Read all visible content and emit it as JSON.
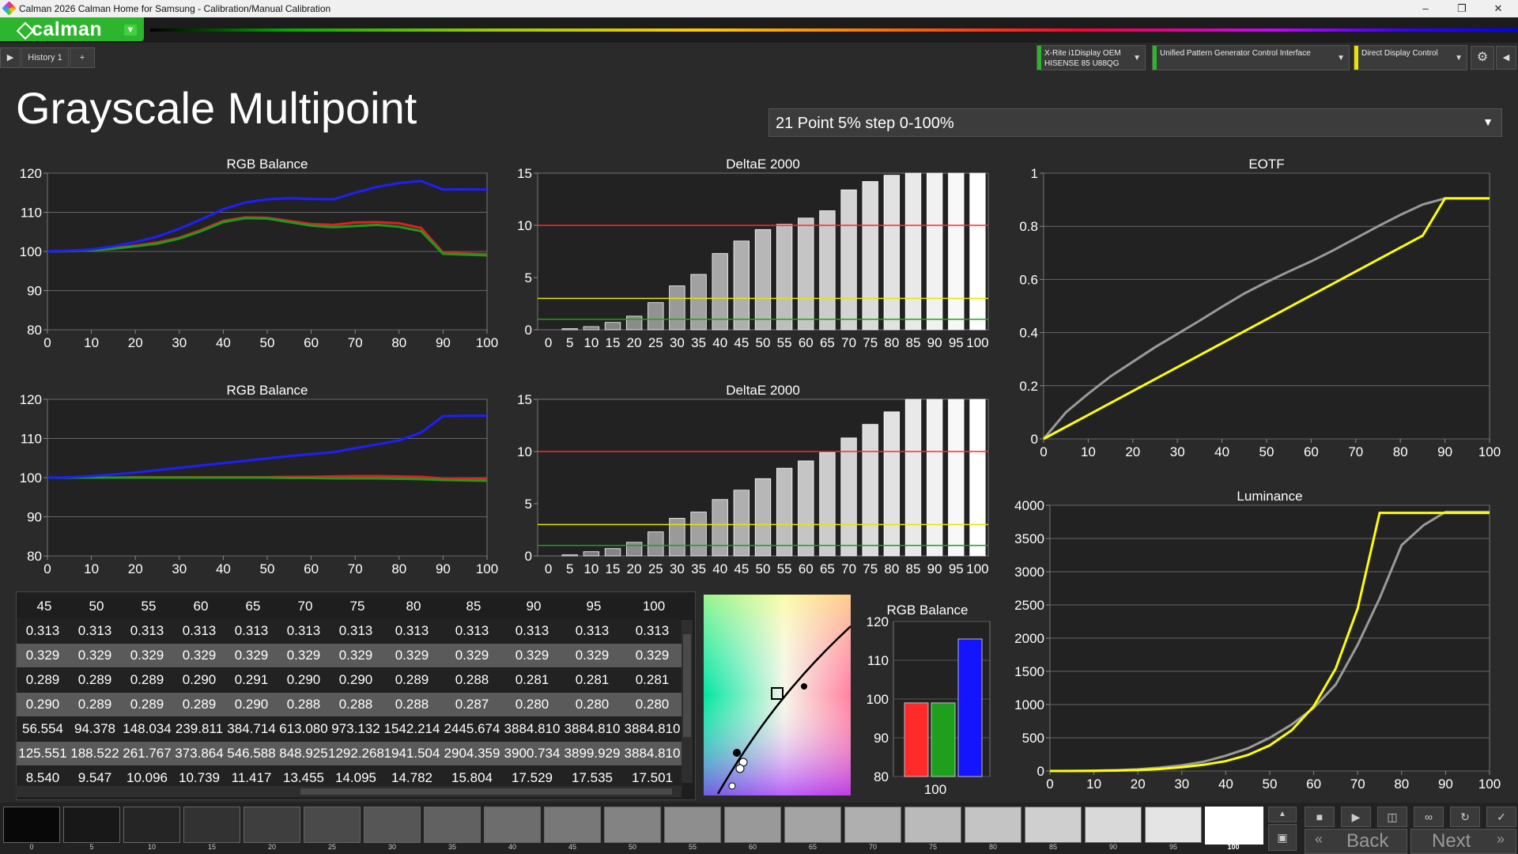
{
  "window": {
    "title": "Calman 2026 Calman Home for Samsung  - Calibration/Manual Calibration"
  },
  "app": {
    "logo": "calman"
  },
  "tabs": {
    "history": "History 1",
    "add": "+"
  },
  "devices": [
    {
      "line1": "X-Rite i1Display OEM",
      "line2": "HISENSE 85 U88QG",
      "color": "#2db52d"
    },
    {
      "line1": "Unified Pattern Generator Control Interface",
      "line2": "",
      "color": "#2db52d"
    },
    {
      "line1": "Direct Display Control",
      "line2": "",
      "color": "#e6e600"
    }
  ],
  "page": {
    "title": "Grayscale Multipoint",
    "preset": "21 Point 5% step 0-100%"
  },
  "chart_data": [
    {
      "id": "rgb1",
      "type": "line",
      "title": "RGB Balance",
      "x": [
        0,
        5,
        10,
        15,
        20,
        25,
        30,
        35,
        40,
        45,
        50,
        55,
        60,
        65,
        70,
        75,
        80,
        85,
        90,
        95,
        100
      ],
      "ylim": [
        80,
        120
      ],
      "yticks": [
        80,
        90,
        100,
        110,
        120
      ],
      "xticks": [
        0,
        10,
        20,
        30,
        40,
        50,
        60,
        70,
        80,
        90,
        100
      ],
      "series": [
        {
          "name": "Red",
          "color": "#e02020",
          "values": [
            100,
            100.1,
            100.3,
            100.8,
            101.5,
            102.3,
            103.5,
            105.5,
            107.8,
            108.7,
            108.6,
            107.8,
            107,
            106.8,
            107.4,
            107.5,
            107.2,
            106,
            99.7,
            99.5,
            99.3
          ]
        },
        {
          "name": "Green",
          "color": "#1e9a1e",
          "values": [
            100,
            100.1,
            100.3,
            100.7,
            101.3,
            102,
            103.3,
            105.2,
            107.5,
            108.5,
            108.4,
            107.5,
            106.6,
            106.2,
            106.5,
            106.8,
            106.3,
            105.2,
            99.4,
            99.2,
            99
          ]
        },
        {
          "name": "Blue",
          "color": "#1e1eff",
          "values": [
            100,
            100.2,
            100.5,
            101.3,
            102.4,
            103.8,
            105.8,
            108.2,
            110.8,
            112.5,
            113.3,
            113.6,
            113.4,
            113.3,
            115,
            116.5,
            117.5,
            118,
            115.8,
            115.9,
            115.8
          ]
        }
      ]
    },
    {
      "id": "de1",
      "type": "bar",
      "title": "DeltaE 2000",
      "categories": [
        "0",
        "5",
        "10",
        "15",
        "20",
        "25",
        "30",
        "35",
        "40",
        "45",
        "50",
        "55",
        "60",
        "65",
        "70",
        "75",
        "80",
        "85",
        "90",
        "95",
        "100"
      ],
      "values": [
        0,
        0.1,
        0.3,
        0.7,
        1.3,
        2.6,
        4.2,
        5.3,
        7.3,
        8.5,
        9.6,
        10.1,
        10.7,
        11.4,
        13.4,
        14.2,
        14.8,
        15.5,
        15.5,
        15.5,
        15.5
      ],
      "ylim": [
        0,
        15
      ],
      "yticks": [
        0,
        5,
        10,
        15
      ],
      "thresholds": [
        10,
        3,
        1
      ]
    },
    {
      "id": "rgb2",
      "type": "line",
      "title": "RGB Balance",
      "x": [
        0,
        5,
        10,
        15,
        20,
        25,
        30,
        35,
        40,
        45,
        50,
        55,
        60,
        65,
        70,
        75,
        80,
        85,
        90,
        95,
        100
      ],
      "ylim": [
        80,
        120
      ],
      "yticks": [
        80,
        90,
        100,
        110,
        120
      ],
      "xticks": [
        0,
        10,
        20,
        30,
        40,
        50,
        60,
        70,
        80,
        90,
        100
      ],
      "series": [
        {
          "name": "Red",
          "color": "#e02020",
          "values": [
            100,
            100,
            100,
            100,
            100.1,
            100.1,
            100.1,
            100.1,
            100.1,
            100.1,
            100.1,
            100.2,
            100.2,
            100.3,
            100.4,
            100.4,
            100.3,
            100.2,
            99.8,
            99.7,
            99.6
          ]
        },
        {
          "name": "Green",
          "color": "#1e9a1e",
          "values": [
            100,
            100,
            100,
            100,
            100,
            100,
            100,
            100,
            100,
            100,
            100,
            99.9,
            99.9,
            99.8,
            99.8,
            99.8,
            99.7,
            99.6,
            99.4,
            99.3,
            99.2
          ]
        },
        {
          "name": "Blue",
          "color": "#1e1eff",
          "values": [
            100,
            100.1,
            100.4,
            100.8,
            101.3,
            101.9,
            102.5,
            103.1,
            103.7,
            104.3,
            104.9,
            105.5,
            106,
            106.5,
            107.5,
            108.5,
            109.5,
            111.5,
            115.7,
            115.8,
            115.8
          ]
        }
      ]
    },
    {
      "id": "de2",
      "type": "bar",
      "title": "DeltaE 2000",
      "categories": [
        "0",
        "5",
        "10",
        "15",
        "20",
        "25",
        "30",
        "35",
        "40",
        "45",
        "50",
        "55",
        "60",
        "65",
        "70",
        "75",
        "80",
        "85",
        "90",
        "95",
        "100"
      ],
      "values": [
        0,
        0.1,
        0.4,
        0.7,
        1.3,
        2.3,
        3.6,
        4.2,
        5.4,
        6.3,
        7.4,
        8.4,
        9.1,
        9.9,
        11.3,
        12.6,
        13.8,
        15.5,
        15.5,
        15.5,
        15.5
      ],
      "ylim": [
        0,
        15
      ],
      "yticks": [
        0,
        5,
        10,
        15
      ],
      "thresholds": [
        10,
        3,
        1
      ]
    },
    {
      "id": "eotf",
      "type": "line",
      "title": "EOTF",
      "x": [
        0,
        5,
        10,
        15,
        20,
        25,
        30,
        35,
        40,
        45,
        50,
        55,
        60,
        65,
        70,
        75,
        80,
        85,
        90,
        95,
        100
      ],
      "ylim": [
        0,
        1
      ],
      "yticks": [
        0,
        0.2,
        0.4,
        0.6,
        0.8,
        1
      ],
      "xticks": [
        0,
        10,
        20,
        30,
        40,
        50,
        60,
        70,
        80,
        90,
        100
      ],
      "series": [
        {
          "name": "Target",
          "color": "#9a9a9a",
          "values": [
            0,
            0.1,
            0.17,
            0.235,
            0.29,
            0.345,
            0.395,
            0.445,
            0.497,
            0.547,
            0.59,
            0.63,
            0.668,
            0.71,
            0.755,
            0.8,
            0.843,
            0.882,
            0.905,
            0.905,
            0.905
          ]
        },
        {
          "name": "Measured",
          "color": "#ffff00",
          "values": [
            0,
            0.045,
            0.09,
            0.135,
            0.18,
            0.225,
            0.27,
            0.315,
            0.36,
            0.405,
            0.45,
            0.495,
            0.54,
            0.585,
            0.63,
            0.675,
            0.72,
            0.765,
            0.905,
            0.905,
            0.905
          ]
        }
      ]
    },
    {
      "id": "lum",
      "type": "line",
      "title": "Luminance",
      "x": [
        0,
        5,
        10,
        15,
        20,
        25,
        30,
        35,
        40,
        45,
        50,
        55,
        60,
        65,
        70,
        75,
        80,
        85,
        90,
        95,
        100
      ],
      "ylim": [
        0,
        4000
      ],
      "yticks": [
        0,
        500,
        1000,
        1500,
        2000,
        2500,
        3000,
        3500,
        4000
      ],
      "xticks": [
        0,
        10,
        20,
        30,
        40,
        50,
        60,
        70,
        80,
        90,
        100
      ],
      "series": [
        {
          "name": "Target",
          "color": "#9a9a9a",
          "values": [
            0,
            1,
            5,
            12,
            25,
            50,
            85,
            140,
            230,
            340,
            500,
            700,
            950,
            1300,
            1900,
            2600,
            3400,
            3700,
            3900,
            3900,
            3900
          ]
        },
        {
          "name": "Measured",
          "color": "#ffff00",
          "values": [
            0,
            0.5,
            2,
            6,
            14,
            30,
            56,
            94,
            148,
            240,
            385,
            613,
            973,
            1542,
            2446,
            3885,
            3885,
            3885,
            3885,
            3885,
            3885
          ]
        }
      ]
    },
    {
      "id": "rgbbar",
      "type": "bar",
      "title": "RGB Balance",
      "categories": [
        "100"
      ],
      "series": [
        {
          "name": "R",
          "color": "#ff2a2a",
          "values": [
            99
          ]
        },
        {
          "name": "G",
          "color": "#1ea01e",
          "values": [
            99
          ]
        },
        {
          "name": "B",
          "color": "#1414ff",
          "values": [
            115.5
          ]
        }
      ],
      "ylim": [
        80,
        120
      ],
      "yticks": [
        80,
        90,
        100,
        110,
        120
      ]
    }
  ],
  "table": {
    "headers": [
      "45",
      "50",
      "55",
      "60",
      "65",
      "70",
      "75",
      "80",
      "85",
      "90",
      "95",
      "100"
    ],
    "rows": [
      [
        "0.313",
        "0.313",
        "0.313",
        "0.313",
        "0.313",
        "0.313",
        "0.313",
        "0.313",
        "0.313",
        "0.313",
        "0.313",
        "0.313"
      ],
      [
        "0.329",
        "0.329",
        "0.329",
        "0.329",
        "0.329",
        "0.329",
        "0.329",
        "0.329",
        "0.329",
        "0.329",
        "0.329",
        "0.329"
      ],
      [
        "0.289",
        "0.289",
        "0.289",
        "0.290",
        "0.291",
        "0.290",
        "0.290",
        "0.289",
        "0.288",
        "0.281",
        "0.281",
        "0.281"
      ],
      [
        "0.290",
        "0.289",
        "0.289",
        "0.289",
        "0.290",
        "0.288",
        "0.288",
        "0.288",
        "0.287",
        "0.280",
        "0.280",
        "0.280"
      ],
      [
        "56.554",
        "94.378",
        "148.034",
        "239.811",
        "384.714",
        "613.080",
        "973.132",
        "1542.214",
        "2445.674",
        "3884.810",
        "3884.810",
        "3884.810"
      ],
      [
        "125.551",
        "188.522",
        "261.767",
        "373.864",
        "546.588",
        "848.925",
        "1292.268",
        "1941.504",
        "2904.359",
        "3900.734",
        "3899.929",
        "3884.810"
      ],
      [
        "8.540",
        "9.547",
        "10.096",
        "10.739",
        "11.417",
        "13.455",
        "14.095",
        "14.782",
        "15.804",
        "17.529",
        "17.535",
        "17.501"
      ]
    ]
  },
  "swatches": {
    "labels": [
      "0",
      "5",
      "10",
      "15",
      "20",
      "25",
      "30",
      "35",
      "40",
      "45",
      "50",
      "55",
      "60",
      "65",
      "70",
      "75",
      "80",
      "85",
      "90",
      "95",
      "100"
    ],
    "selected": "100"
  },
  "nav": {
    "back": "Back",
    "next": "Next"
  },
  "icons": [
    "play-icon",
    "settings-gear-icon",
    "collapse-icon",
    "stop-icon",
    "record-icon",
    "save-icon",
    "loop-icon",
    "refresh-icon",
    "check-icon"
  ]
}
